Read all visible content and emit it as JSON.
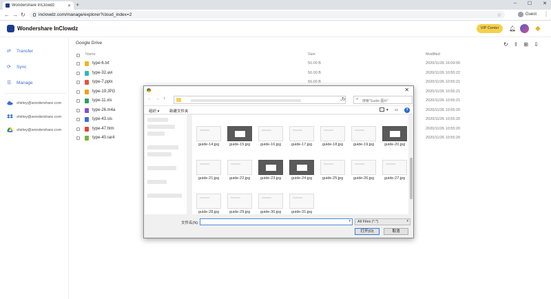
{
  "browser": {
    "tab_title": "Wondershare InClowdz",
    "url": "inclowdz.com/manage/explorer?cloud_index=2",
    "profile": "Guest"
  },
  "app": {
    "logo_text": "Wondershare InClowdz",
    "vip_label": "VIP Center"
  },
  "sidebar": {
    "nav": [
      {
        "label": "Transfer",
        "icon": "transfer-icon"
      },
      {
        "label": "Sync",
        "icon": "sync-icon"
      },
      {
        "label": "Manage",
        "icon": "manage-icon"
      }
    ],
    "accounts": [
      {
        "label": "shirley@wondershare.com",
        "icon": "onedrive-icon",
        "color": "#3b6fd1"
      },
      {
        "label": "shirley@wondershare.com",
        "icon": "dropbox-icon",
        "color": "#1e62d0"
      },
      {
        "label": "shirley@wondershare.com",
        "icon": "google-drive-icon",
        "color": "#1fa463"
      }
    ]
  },
  "main": {
    "breadcrumb": "Google Drive",
    "columns": {
      "name": "Name",
      "size": "Size",
      "modified": "Modified"
    },
    "files": [
      {
        "name": "type-6.txt",
        "size": "50.00 B",
        "modified": "2020/11/26 16:09:00",
        "color": "#f2b51b"
      },
      {
        "name": "type-32.avi",
        "size": "50.00 B",
        "modified": "2020/11/26 10:55:22",
        "color": "#2cb7c2"
      },
      {
        "name": "type-7.pptx",
        "size": "50.00 B",
        "modified": "2020/11/26 10:55:21",
        "color": "#e4533e"
      },
      {
        "name": "type-19.JPG",
        "size": "50.00 B",
        "modified": "2020/11/26 10:55:21",
        "color": "#f2a01b"
      },
      {
        "name": "type-11.xls",
        "size": "50.00 B",
        "modified": "2020/11/26 10:55:21",
        "color": "#2aa25a"
      },
      {
        "name": "type-26.m4a",
        "size": "50.00 B",
        "modified": "2020/11/26 10:55:20",
        "color": "#8a4ed3"
      },
      {
        "name": "type-43.sis",
        "size": "50.00 B",
        "modified": "2020/11/26 10:55:20",
        "color": "#3b6fd1"
      },
      {
        "name": "type-47.htm",
        "size": "50.00 B",
        "modified": "2020/11/26 10:55:20",
        "color": "#e94235"
      },
      {
        "name": "type-40.rar4",
        "size": "50.00 B",
        "modified": "2020/11/26 10:55:20",
        "color": "#7bb33c"
      }
    ]
  },
  "dialog": {
    "search_placeholder": "搜索\"Guide 图片\"",
    "organize": "组织 ▾",
    "new_folder": "新建文件夹",
    "thumbnails": [
      {
        "label": "guide-14.jpg",
        "dark": false
      },
      {
        "label": "guide-15.jpg",
        "dark": true
      },
      {
        "label": "guide-16.jpg",
        "dark": false
      },
      {
        "label": "guide-17.jpg",
        "dark": false
      },
      {
        "label": "guide-18.jpg",
        "dark": false
      },
      {
        "label": "guide-19.jpg",
        "dark": false
      },
      {
        "label": "guide-20.jpg",
        "dark": true
      },
      {
        "label": "guide-21.jpg",
        "dark": false
      },
      {
        "label": "guide-22.jpg",
        "dark": false
      },
      {
        "label": "guide-23.jpg",
        "dark": true
      },
      {
        "label": "guide-24.jpg",
        "dark": true
      },
      {
        "label": "guide-25.jpg",
        "dark": false
      },
      {
        "label": "guide-26.jpg",
        "dark": false
      },
      {
        "label": "guide-27.jpg",
        "dark": false
      },
      {
        "label": "guide-28.jpg",
        "dark": false
      },
      {
        "label": "guide-29.jpg",
        "dark": false
      },
      {
        "label": "guide-30.jpg",
        "dark": false
      },
      {
        "label": "guide-31.jpg",
        "dark": false
      }
    ],
    "filename_label": "文件名(N):",
    "filename_value": "",
    "filetype": "All Files (*.*)",
    "open_label": "打开(O)",
    "cancel_label": "取消"
  }
}
